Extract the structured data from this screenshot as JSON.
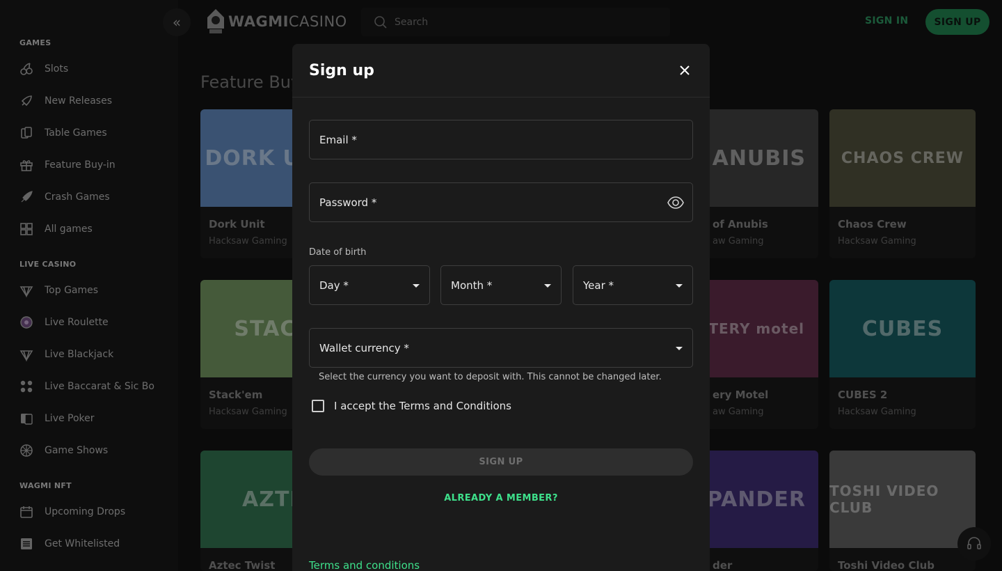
{
  "sidebar": {
    "sections": [
      {
        "title": "GAMES",
        "items": [
          {
            "label": "Slots",
            "icon": "cherries-icon"
          },
          {
            "label": "New Releases",
            "icon": "rocket-icon"
          },
          {
            "label": "Table Games",
            "icon": "cards-icon"
          },
          {
            "label": "Feature Buy-in",
            "icon": "gift-icon"
          },
          {
            "label": "Crash Games",
            "icon": "crash-rocket-icon"
          },
          {
            "label": "All games",
            "icon": "grid-icon"
          }
        ]
      },
      {
        "title": "LIVE CASINO",
        "items": [
          {
            "label": "Top Games",
            "icon": "diamond-icon"
          },
          {
            "label": "Live Roulette",
            "icon": "roulette-icon"
          },
          {
            "label": "Live Blackjack",
            "icon": "diamond-icon"
          },
          {
            "label": "Live Baccarat & Sic Bo",
            "icon": "dice-icon"
          },
          {
            "label": "Live Poker",
            "icon": "poker-cards-icon"
          },
          {
            "label": "Game Shows",
            "icon": "wheel-icon"
          }
        ]
      },
      {
        "title": "WAGMI NFT",
        "items": [
          {
            "label": "Upcoming Drops",
            "icon": "calendar-icon"
          },
          {
            "label": "Get Whitelisted",
            "icon": "list-icon"
          }
        ]
      }
    ]
  },
  "topbar": {
    "logo_bold": "WAGMI",
    "logo_thin": "CASINO",
    "search_placeholder": "Search",
    "signin_label": "SIGN IN",
    "signup_label": "SIGN UP"
  },
  "main": {
    "title": "Feature Buy",
    "cards": [
      {
        "name": "Dork Unit",
        "provider": "Hacksaw Gaming",
        "art": "DORK UNIT",
        "color": "#5a7fb0"
      },
      {
        "name": "of Anubis",
        "provider": "aw Gaming",
        "art": "ANUBIS",
        "color": "#3c3c3c"
      },
      {
        "name": "Chaos Crew",
        "provider": "Hacksaw Gaming",
        "art": "CHAOS CREW",
        "color": "#4a4a38"
      },
      {
        "name": "Stack'em",
        "provider": "Hacksaw Gaming",
        "art": "STACK",
        "color": "#6a8a5a"
      },
      {
        "name": "ery Motel",
        "provider": "aw Gaming",
        "art": "YSTERY motel",
        "color": "#5a2a44"
      },
      {
        "name": "CUBES 2",
        "provider": "Hacksaw Gaming",
        "art": "CUBES",
        "color": "#14555a"
      },
      {
        "name": "Aztec Twist",
        "provider": "",
        "art": "AZTE",
        "color": "#2e6a4a"
      },
      {
        "name": "der",
        "provider": "",
        "art": "PANDER",
        "color": "#3a2a6a"
      },
      {
        "name": "Toshi Video Club",
        "provider": "",
        "art": "TOSHI VIDEO CLUB",
        "color": "#5a5a5a"
      }
    ]
  },
  "modal": {
    "title": "Sign up",
    "email_label": "Email *",
    "password_label": "Password *",
    "dob_label": "Date of birth",
    "day_label": "Day *",
    "month_label": "Month *",
    "year_label": "Year *",
    "currency_label": "Wallet currency *",
    "currency_helper": "Select the currency you want to deposit with. This cannot be changed later.",
    "terms_label": "I accept the Terms and Conditions",
    "submit_label": "SIGN UP",
    "member_link": "ALREADY A MEMBER?",
    "footer_link": "Terms and conditions"
  },
  "colors": {
    "accent": "#3ee08b",
    "accent_dim": "#1f7a4b",
    "modal_bg": "#1b1b1b",
    "page_bg": "#111111"
  }
}
